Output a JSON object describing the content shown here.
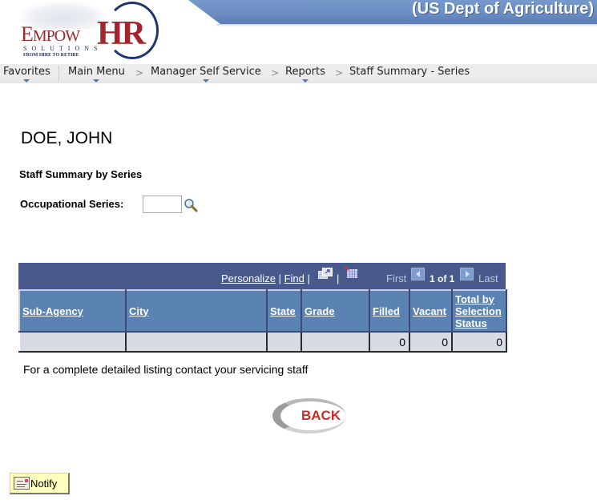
{
  "header": {
    "org_title": "(US Dept of Agriculture)",
    "logo": {
      "brand_prefix_big": "E",
      "brand_prefix_small": "MPOW",
      "brand_suffix": "HR",
      "subtitle": "SOLUTIONS",
      "tagline": "FROM HIRE TO RETIRE"
    }
  },
  "nav": {
    "items": [
      {
        "label": "Favorites",
        "has_dropdown": true
      },
      {
        "label": "Main Menu",
        "has_dropdown": true
      },
      {
        "label": "Manager Self Service",
        "has_dropdown": true
      },
      {
        "label": "Reports",
        "has_dropdown": true
      },
      {
        "label": "Staff Summary - Series",
        "has_dropdown": false
      }
    ],
    "separator": ">"
  },
  "page": {
    "employee_name": "DOE, JOHN",
    "section_title": "Staff Summary by Series",
    "occupational_series": {
      "label": "Occupational Series:",
      "value": "",
      "lookup_icon": "magnifier-icon"
    }
  },
  "grid": {
    "toolbar": {
      "personalize": "Personalize",
      "find": "Find",
      "pipe": "|",
      "view_all_icon": "new-window-icon",
      "download_icon": "download-to-excel-icon",
      "first": "First",
      "pagination": "1 of 1",
      "last": "Last"
    },
    "columns": [
      "Sub-Agency",
      "City",
      "State",
      "Grade",
      "Filled",
      "Vacant",
      "Total by Selection Status"
    ],
    "rows": [
      [
        "",
        "",
        "",
        "",
        "0",
        "0",
        "0"
      ]
    ]
  },
  "footnote": "For a complete detailed listing contact your servicing staff",
  "back_button": {
    "label": "BACK"
  },
  "notify_button": {
    "label": "Notify",
    "icon": "notify-envelope-icon"
  },
  "colors": {
    "banner": "#6a8cc2",
    "grid_toolbar": "#485a8c",
    "grid_header": "#5a82b2",
    "grid_row": "#d6dbe4",
    "brand_red": "#a3262c",
    "back_red": "#d12a2a",
    "notify_bg": "#ffffc0"
  }
}
